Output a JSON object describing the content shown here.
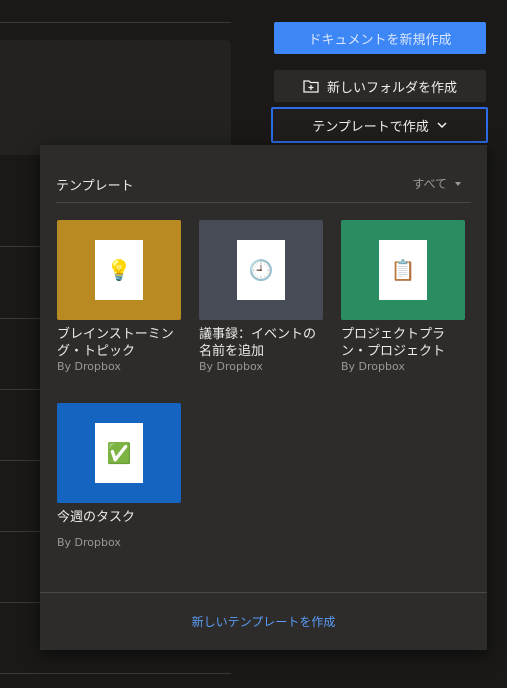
{
  "buttons": {
    "create_document": "ドキュメントを新規作成",
    "new_folder": "新しいフォルダを作成",
    "create_from_template": "テンプレートで作成"
  },
  "templates_panel": {
    "title": "テンプレート",
    "filter": "すべて",
    "items": [
      {
        "name": "ブレインストーミング・トピック",
        "by": "By Dropbox",
        "color": "#b98a22",
        "icon": "lightbulb-icon",
        "glyph": "💡"
      },
      {
        "name": "議事録：イベントの名前を追加",
        "by": "By Dropbox",
        "color": "#474b55",
        "icon": "clock-icon",
        "glyph": "🕘"
      },
      {
        "name": "プロジェクトプラン・プロジェクト",
        "by": "By Dropbox",
        "color": "#2a8c61",
        "icon": "clipboard-icon",
        "glyph": "📋"
      },
      {
        "name": "今週のタスク",
        "by": "By Dropbox",
        "color": "#1565c0",
        "icon": "checkmark-icon",
        "glyph": "✅"
      }
    ],
    "footer_link": "新しいテンプレートを作成"
  },
  "colors": {
    "primary": "#3d86f5",
    "focus_border": "#2e6be6",
    "link": "#5b9cf6"
  }
}
